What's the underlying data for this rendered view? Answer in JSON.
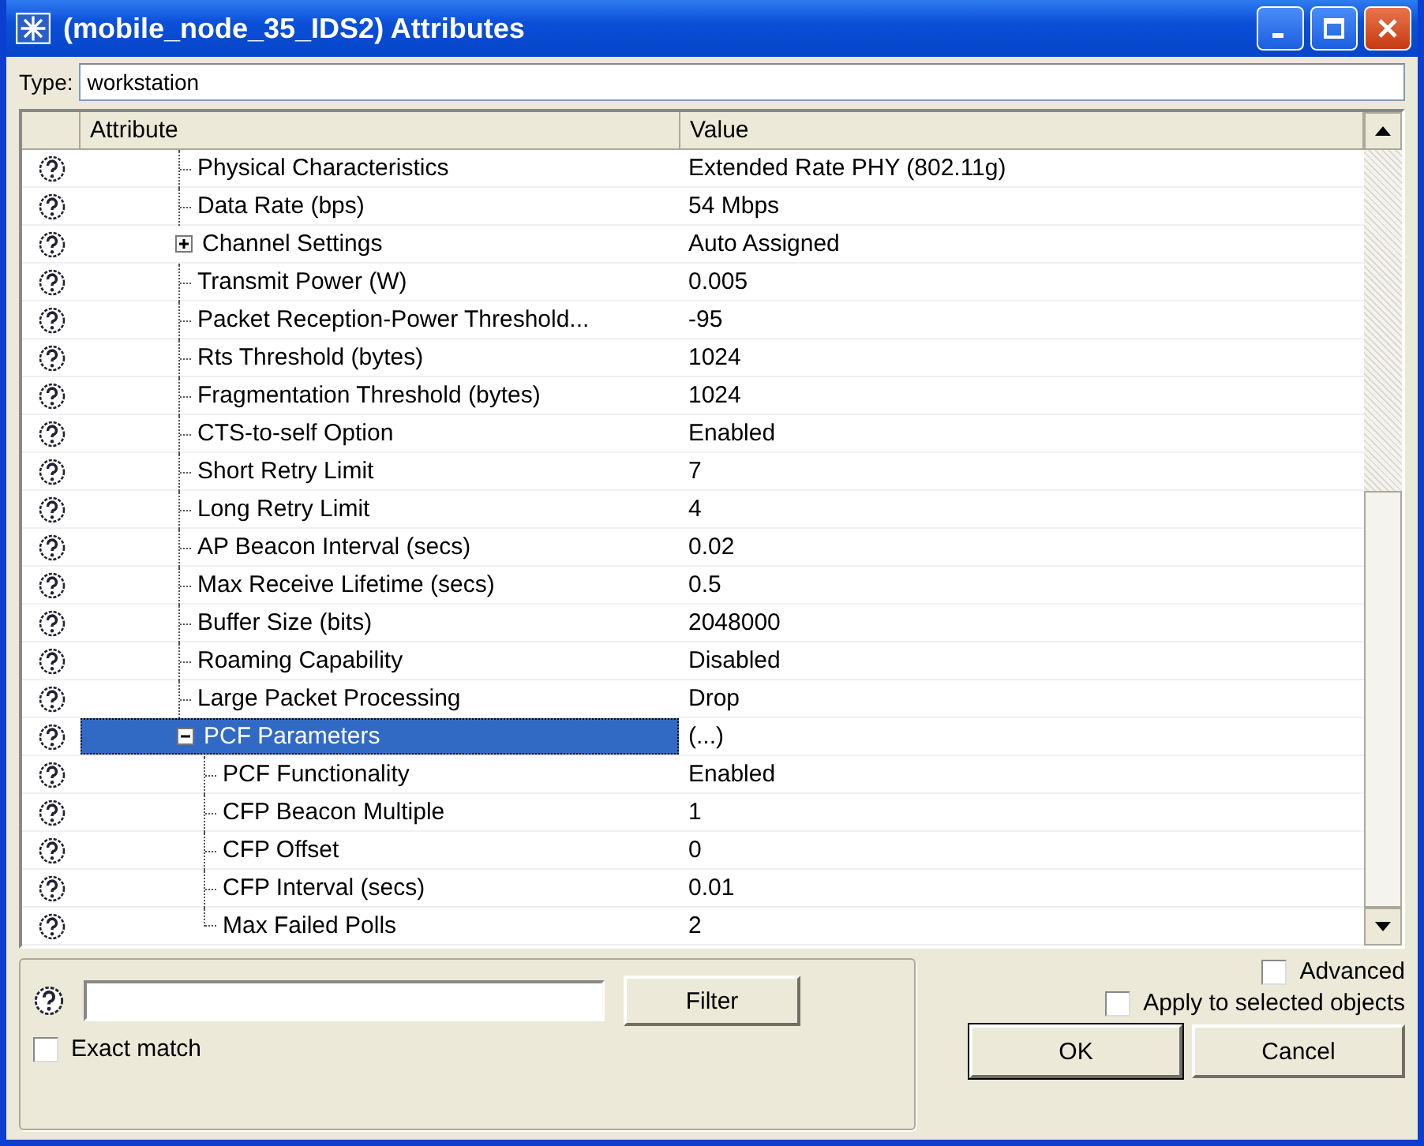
{
  "window": {
    "title": "(mobile_node_35_IDS2) Attributes"
  },
  "type_field": {
    "label": "Type:",
    "value": "workstation"
  },
  "table": {
    "columns": [
      "Attribute",
      "Value"
    ],
    "rows": [
      {
        "name": "Physical Characteristics",
        "value": "Extended Rate PHY (802.11g)",
        "selected": false
      },
      {
        "name": "Data Rate (bps)",
        "value": "54 Mbps",
        "selected": false
      },
      {
        "name": "Channel Settings",
        "value": "Auto Assigned",
        "selected": false,
        "expanded": false
      },
      {
        "name": "Transmit Power (W)",
        "value": "0.005",
        "selected": false
      },
      {
        "name": "Packet Reception-Power Threshold...",
        "value": "-95",
        "selected": false
      },
      {
        "name": "Rts Threshold (bytes)",
        "value": "1024",
        "selected": false
      },
      {
        "name": "Fragmentation Threshold (bytes)",
        "value": "1024",
        "selected": false
      },
      {
        "name": "CTS-to-self Option",
        "value": "Enabled",
        "selected": false
      },
      {
        "name": "Short Retry Limit",
        "value": "7",
        "selected": false
      },
      {
        "name": "Long Retry Limit",
        "value": "4",
        "selected": false
      },
      {
        "name": "AP Beacon Interval (secs)",
        "value": "0.02",
        "selected": false
      },
      {
        "name": "Max Receive Lifetime (secs)",
        "value": "0.5",
        "selected": false
      },
      {
        "name": "Buffer Size (bits)",
        "value": "2048000",
        "selected": false
      },
      {
        "name": "Roaming Capability",
        "value": "Disabled",
        "selected": false
      },
      {
        "name": "Large Packet Processing",
        "value": "Drop",
        "selected": false
      },
      {
        "name": "PCF Parameters",
        "value": "(...)",
        "selected": true,
        "expanded": true,
        "children": [
          {
            "name": "PCF Functionality",
            "value": "Enabled",
            "selected": false
          },
          {
            "name": "CFP Beacon Multiple",
            "value": "1",
            "selected": false
          },
          {
            "name": "CFP Offset",
            "value": "0",
            "selected": false
          },
          {
            "name": "CFP Interval (secs)",
            "value": "0.01",
            "selected": false
          },
          {
            "name": "Max Failed Polls",
            "value": "2",
            "selected": false
          }
        ]
      }
    ]
  },
  "filter": {
    "button": {
      "label": "Filter"
    },
    "exact_match": {
      "label": "Exact match",
      "checked": false
    }
  },
  "options": [
    {
      "label": "Advanced",
      "checked": false
    },
    {
      "label": "Apply to selected objects",
      "checked": false
    }
  ],
  "buttons": [
    {
      "label": "OK"
    },
    {
      "label": "Cancel"
    }
  ]
}
